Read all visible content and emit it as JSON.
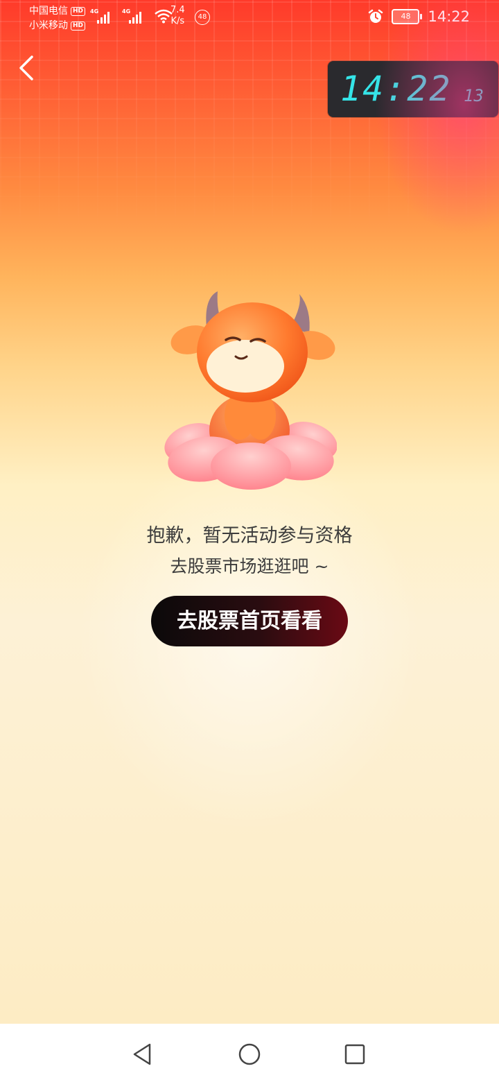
{
  "status_bar": {
    "carrier_1": "中国电信",
    "carrier_2": "小米移动",
    "hd_label": "HD",
    "network_1": "4G",
    "network_2": "4G",
    "speed_value": "7.4",
    "speed_unit": "K/s",
    "notification_count": "48",
    "battery_level": "48",
    "time": "14:22",
    "icons": [
      "signal-icon",
      "wifi-icon",
      "alarm-icon",
      "battery-icon"
    ]
  },
  "header": {
    "back_icon": "chevron-left-icon"
  },
  "clock_widget": {
    "hour_minute": "14:22",
    "seconds": "13",
    "color": "#35e5e8"
  },
  "main": {
    "mascot_icon": "cow-mascot-illustration",
    "message_line_1": "抱歉，暂无活动参与资格",
    "message_line_2": "去股票市场逛逛吧 ~",
    "cta_label": "去股票首页看看"
  },
  "navbar": {
    "icons": [
      "nav-back-icon",
      "nav-home-icon",
      "nav-recent-icon"
    ]
  },
  "colors": {
    "top_red": "#ff3a2a",
    "cta_dark": "#0b0a0a",
    "cta_red": "#6a0a14",
    "text": "#3c3c3c"
  }
}
